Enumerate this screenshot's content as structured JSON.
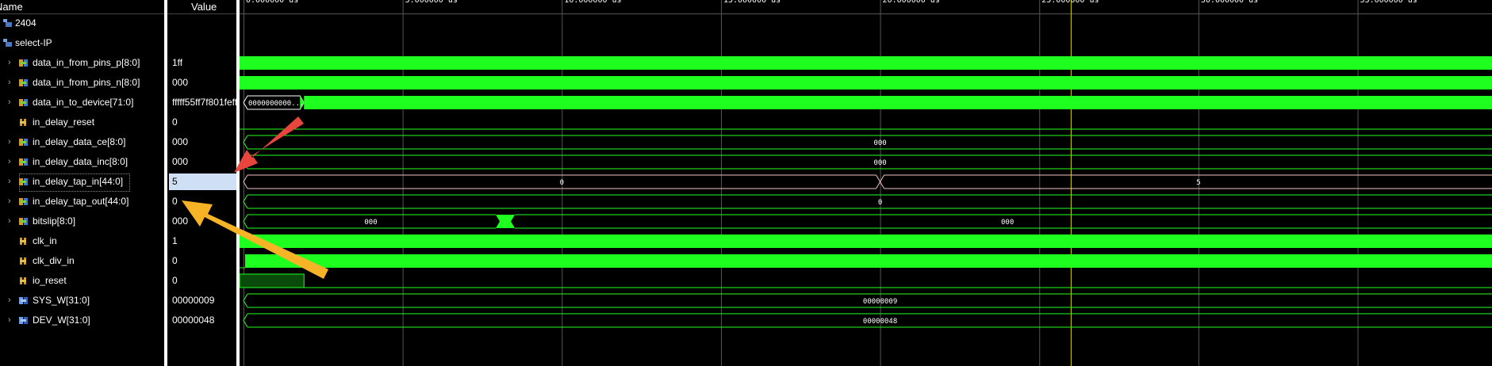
{
  "header": {
    "name_col": "Name",
    "value_col": "Value"
  },
  "timeline": {
    "ticks": [
      "0.000000 us",
      "5.000000 us",
      "10.000000 us",
      "15.000000 us",
      "20.000000 us",
      "25.000000 us",
      "30.000000 us",
      "35.000000 us"
    ],
    "cursor_time_us": 26
  },
  "groups": [
    {
      "label": "2404",
      "icon": "group-icon"
    },
    {
      "label": "select-IP",
      "icon": "group-icon"
    }
  ],
  "signals": [
    {
      "name": "data_in_from_pins_p[8:0]",
      "value": "1ff",
      "expandable": true,
      "icon": "bus-icon"
    },
    {
      "name": "data_in_from_pins_n[8:0]",
      "value": "000",
      "expandable": true,
      "icon": "bus-icon"
    },
    {
      "name": "data_in_to_device[71:0]",
      "value": "fffff55ff7f801feff",
      "expandable": true,
      "icon": "bus-icon",
      "wave_label": "0000000000..."
    },
    {
      "name": "in_delay_reset",
      "value": "0",
      "expandable": false,
      "icon": "bit-icon"
    },
    {
      "name": "in_delay_data_ce[8:0]",
      "value": "000",
      "expandable": true,
      "icon": "bus-icon",
      "wave_label": "000"
    },
    {
      "name": "in_delay_data_inc[8:0]",
      "value": "000",
      "expandable": true,
      "icon": "bus-icon",
      "wave_label": "000"
    },
    {
      "name": "in_delay_tap_in[44:0]",
      "value": "5",
      "expandable": true,
      "icon": "bus-icon",
      "selected": true,
      "wave_labels": [
        "0",
        "5"
      ]
    },
    {
      "name": "in_delay_tap_out[44:0]",
      "value": "0",
      "expandable": true,
      "icon": "bus-icon",
      "wave_label": "0"
    },
    {
      "name": "bitslip[8:0]",
      "value": "000",
      "expandable": true,
      "icon": "bus-icon",
      "wave_labels": [
        "000",
        "000"
      ]
    },
    {
      "name": "clk_in",
      "value": "1",
      "expandable": false,
      "icon": "bit-icon"
    },
    {
      "name": "clk_div_in",
      "value": "0",
      "expandable": false,
      "icon": "bit-icon"
    },
    {
      "name": "io_reset",
      "value": "0",
      "expandable": false,
      "icon": "bit-icon"
    },
    {
      "name": "SYS_W[31:0]",
      "value": "00000009",
      "expandable": true,
      "icon": "const-icon",
      "wave_label": "00000009"
    },
    {
      "name": "DEV_W[31:0]",
      "value": "00000048",
      "expandable": true,
      "icon": "const-icon",
      "wave_label": "00000048"
    }
  ],
  "annotations": [
    {
      "name": "red-arrow",
      "color": "#e8463c"
    },
    {
      "name": "yellow-arrow",
      "color": "#f5b325"
    }
  ],
  "colors": {
    "wave": "#1fff1f",
    "wave_dark": "#0a4a0a",
    "cursor": "#d8d800",
    "selection": "#cfe0f6"
  }
}
